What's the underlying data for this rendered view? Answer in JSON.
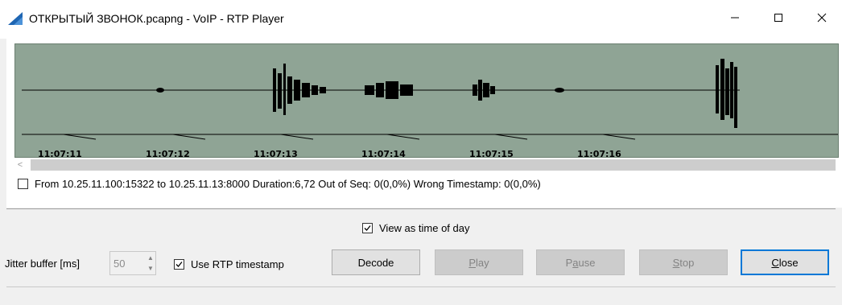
{
  "window": {
    "title": "ОТКРЫТЫЙ ЗВОНОК.pcapng - VoIP - RTP Player",
    "icon": "wireshark-fin-icon",
    "controls": [
      "minimize-icon",
      "maximize-icon",
      "close-icon"
    ]
  },
  "timeline": {
    "waveform_color": "#000000",
    "background_color": "#8fa495",
    "ticks": [
      "11:07:11",
      "11:07:12",
      "11:07:13",
      "11:07:14",
      "11:07:15",
      "11:07:16"
    ]
  },
  "stream": {
    "checked": false,
    "description": "From 10.25.11.100:15322 to 10.25.11.13:8000  Duration:6,72  Out of Seq: 0(0,0%)  Wrong Timestamp: 0(0,0%)"
  },
  "options": {
    "view_time_of_day_label": "View as time of day",
    "view_time_of_day_checked": true,
    "jitter_label": "Jitter buffer [ms]",
    "jitter_value": "50",
    "use_rtp_label": "Use RTP timestamp",
    "use_rtp_checked": true
  },
  "buttons": {
    "decode": "Decode",
    "play_prefix": "",
    "play_mnemonic": "P",
    "play_rest": "lay",
    "pause_prefix": "P",
    "pause_mnemonic": "a",
    "pause_rest": "use",
    "stop_prefix": "",
    "stop_mnemonic": "S",
    "stop_rest": "top",
    "close_prefix": "",
    "close_mnemonic": "C",
    "close_rest": "lose"
  }
}
